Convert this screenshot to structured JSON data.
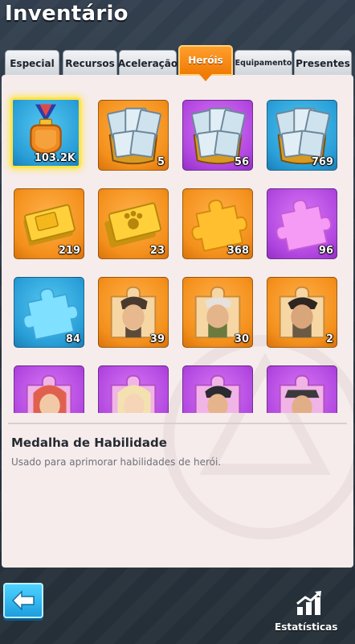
{
  "header": {
    "title": "Inventário"
  },
  "tabs": [
    {
      "label": "Especial",
      "active": false
    },
    {
      "label": "Recursos",
      "active": false
    },
    {
      "label": "Aceleração",
      "active": false
    },
    {
      "label": "Heróis",
      "active": true
    },
    {
      "label": "Equipamento",
      "active": false
    },
    {
      "label": "Presentes",
      "active": false
    }
  ],
  "items": [
    {
      "icon": "skill-medal-icon",
      "bg": "blue",
      "count": "103.2K",
      "selected": true
    },
    {
      "icon": "exp-book-chest-icon",
      "bg": "orange",
      "count": "5"
    },
    {
      "icon": "exp-book-chest-icon",
      "bg": "purple",
      "count": "56"
    },
    {
      "icon": "exp-book-chest-icon",
      "bg": "blue",
      "count": "769"
    },
    {
      "icon": "gold-ticket-icon",
      "bg": "orange",
      "count": "219"
    },
    {
      "icon": "paw-ticket-icon",
      "bg": "orange",
      "count": "23"
    },
    {
      "icon": "gold-puzzle-piece-icon",
      "bg": "orange",
      "count": "368"
    },
    {
      "icon": "pink-puzzle-piece-icon",
      "bg": "purple",
      "count": "96"
    },
    {
      "icon": "blue-puzzle-piece-icon",
      "bg": "blue",
      "count": "84"
    },
    {
      "icon": "hero-fragment-icon",
      "bg": "orange",
      "count": "39"
    },
    {
      "icon": "hero-fragment-icon",
      "bg": "orange",
      "count": "30"
    },
    {
      "icon": "hero-fragment-icon",
      "bg": "orange",
      "count": "2"
    },
    {
      "icon": "hero-fragment-icon",
      "bg": "purple",
      "count": ""
    },
    {
      "icon": "hero-fragment-icon",
      "bg": "purple",
      "count": ""
    },
    {
      "icon": "hero-fragment-icon",
      "bg": "purple",
      "count": ""
    },
    {
      "icon": "hero-fragment-icon",
      "bg": "purple",
      "count": ""
    }
  ],
  "detail": {
    "name": "Medalha de Habilidade",
    "description": "Usado para aprimorar habilidades de herói."
  },
  "footer": {
    "back_icon": "back-arrow-icon",
    "stats_icon": "statistics-icon",
    "stats_label": "Estatísticas"
  },
  "colors": {
    "tab_active": "#f07c06",
    "selection_glow": "#ffe44a",
    "panel_bg": "#f6ecec",
    "back_button": "#1d9ee0"
  }
}
